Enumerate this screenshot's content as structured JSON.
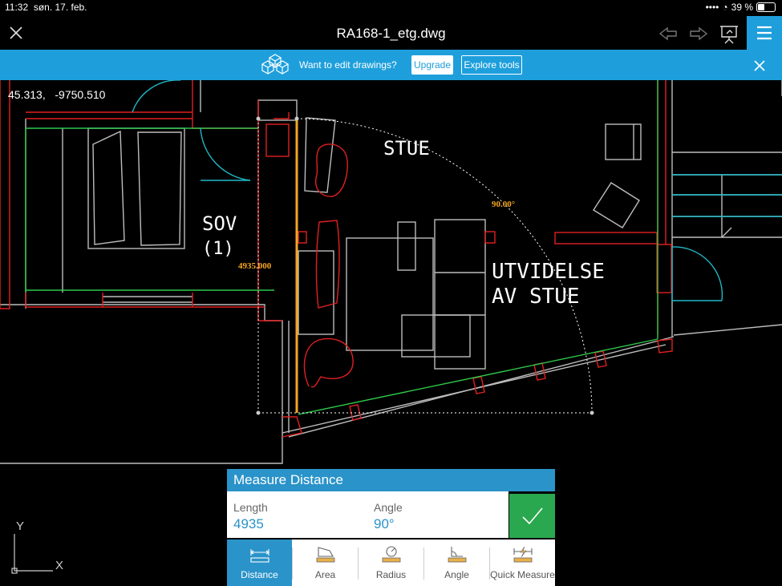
{
  "status": {
    "time": "11:32",
    "date": "søn. 17. feb.",
    "battery": "39 %"
  },
  "titlebar": {
    "title": "RA168-1_etg.dwg"
  },
  "banner": {
    "text": "Want to edit drawings?",
    "upgrade": "Upgrade",
    "explore": "Explore tools"
  },
  "coords": {
    "x": "45.313,",
    "y": "-9750.510"
  },
  "drawing": {
    "room_labels": [
      "STUE",
      "SOV",
      "(1)",
      "UTVIDELSE",
      "AV STUE"
    ],
    "angle_annot": "90.00°",
    "length_annot": "4935.000"
  },
  "measure": {
    "title": "Measure Distance",
    "length_label": "Length",
    "length_value": "4935",
    "angle_label": "Angle",
    "angle_value": "90°"
  },
  "tools": [
    {
      "label": "Distance",
      "active": true
    },
    {
      "label": "Area",
      "active": false
    },
    {
      "label": "Radius",
      "active": false
    },
    {
      "label": "Angle",
      "active": false
    },
    {
      "label": "Quick Measure",
      "active": false
    }
  ],
  "axes": {
    "y": "Y",
    "x": "X"
  },
  "colors": {
    "accent": "#1e9fdc",
    "confirm": "#2aa84f",
    "measure": "#f5a623"
  }
}
